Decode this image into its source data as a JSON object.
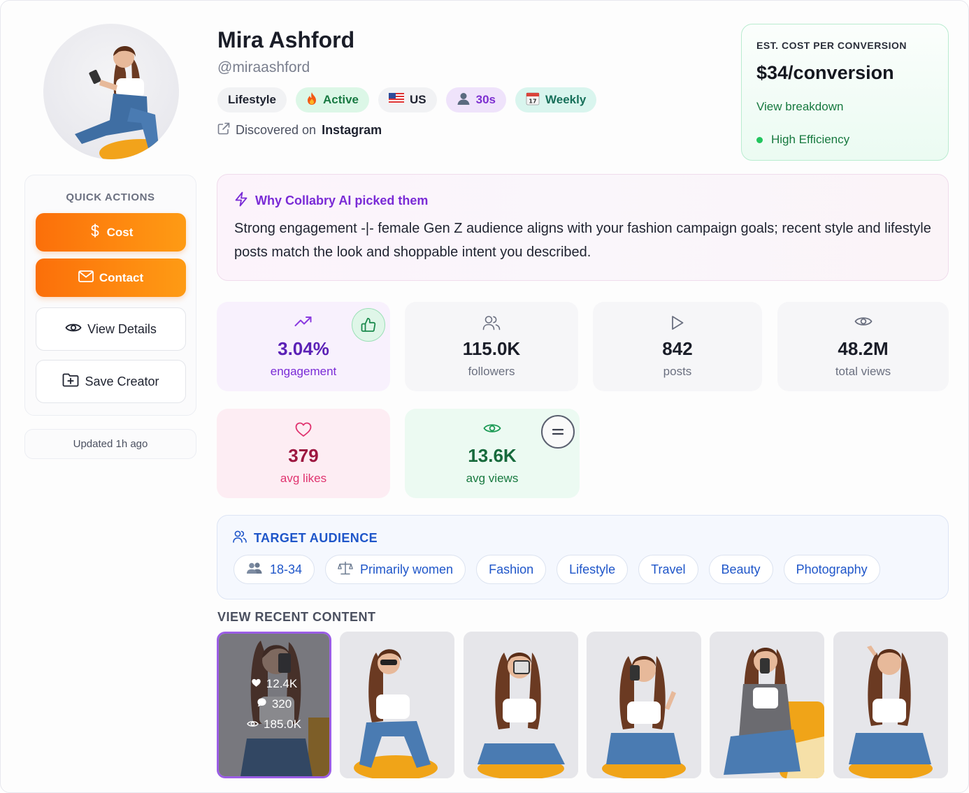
{
  "profile": {
    "name": "Mira Ashford",
    "handle": "@miraashford",
    "discovered_prefix": "Discovered on",
    "discovered_platform": "Instagram",
    "tags": [
      {
        "label": "Lifestyle",
        "icon": "none"
      },
      {
        "label": "Active",
        "icon": "fire-icon"
      },
      {
        "label": "US",
        "icon": "us-flag-icon"
      },
      {
        "label": "30s",
        "icon": "person-icon"
      },
      {
        "label": "Weekly",
        "icon": "calendar-icon"
      }
    ]
  },
  "quick_actions": {
    "title": "QUICK ACTIONS",
    "cost": "Cost",
    "contact": "Contact",
    "view_details": "View Details",
    "save_creator": "Save Creator"
  },
  "updated": "Updated 1h ago",
  "cost_box": {
    "label": "EST. COST PER CONVERSION",
    "value": "$34/conversion",
    "link": "View breakdown",
    "efficiency": "High Efficiency"
  },
  "why": {
    "title": "Why Collabry AI picked them",
    "text": "Strong engagement -|- female Gen Z audience aligns with your fashion campaign goals; recent style and lifestyle posts match the look and shoppable intent you described."
  },
  "stats": {
    "engagement": {
      "value": "3.04%",
      "label": "engagement"
    },
    "followers": {
      "value": "115.0K",
      "label": "followers"
    },
    "posts": {
      "value": "842",
      "label": "posts"
    },
    "total_views": {
      "value": "48.2M",
      "label": "total views"
    },
    "avg_likes": {
      "value": "379",
      "label": "avg likes"
    },
    "avg_views": {
      "value": "13.6K",
      "label": "avg views"
    }
  },
  "audience": {
    "title": "TARGET AUDIENCE",
    "chips": [
      "18-34",
      "Primarily women",
      "Fashion",
      "Lifestyle",
      "Travel",
      "Beauty",
      "Photography"
    ]
  },
  "recent": {
    "title": "VIEW RECENT CONTENT",
    "selected": {
      "likes": "12.4K",
      "comments": "320",
      "views": "185.0K"
    }
  },
  "colors": {
    "accent_orange": "#fb7a0c",
    "purple": "#7a2bd6",
    "green": "#17793f",
    "blue": "#1f56c9",
    "pink": "#e0336f"
  }
}
